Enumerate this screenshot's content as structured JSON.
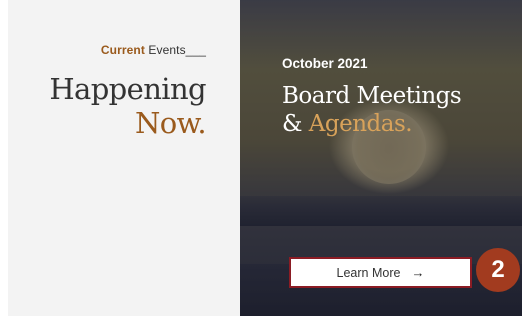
{
  "current_events": {
    "label_accent": "Current",
    "label_rest": "Events___",
    "heading_line1": "Happening",
    "heading_line2": "Now."
  },
  "feature": {
    "date": "October 2021",
    "title_line1": "Board Meetings",
    "title_amp": "&",
    "title_line2": "Agendas.",
    "button_label": "Learn More",
    "button_icon": "arrow-right-icon"
  },
  "annotation": {
    "badge": "2"
  },
  "colors": {
    "accent_brown": "#9a5a1c",
    "accent_gold": "#d8a25a",
    "button_border": "#8b1c24",
    "badge": "#a23b1f"
  }
}
